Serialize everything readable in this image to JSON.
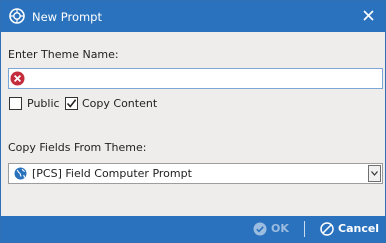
{
  "window": {
    "title": "New Prompt",
    "icon": "prompt-app-icon",
    "close_icon": "close-icon"
  },
  "form": {
    "theme_name_label": "Enter Theme Name:",
    "theme_name_value": "",
    "theme_name_status_icon": "error-icon",
    "public_label": "Public",
    "public_checked": false,
    "copy_content_label": "Copy Content",
    "copy_content_checked": true,
    "copy_fields_label": "Copy Fields From Theme:",
    "copy_fields_selected": "[PCS] Field Computer Prompt",
    "copy_fields_icon": "globe-icon"
  },
  "footer": {
    "ok_label": "OK",
    "ok_icon": "check-circle-icon",
    "ok_enabled": false,
    "cancel_label": "Cancel",
    "cancel_icon": "cancel-icon"
  },
  "colors": {
    "titlebar": "#2a72bd",
    "dialog_bg": "#efedec",
    "error": "#c42b3b",
    "field_border": "#7ba6d6"
  }
}
